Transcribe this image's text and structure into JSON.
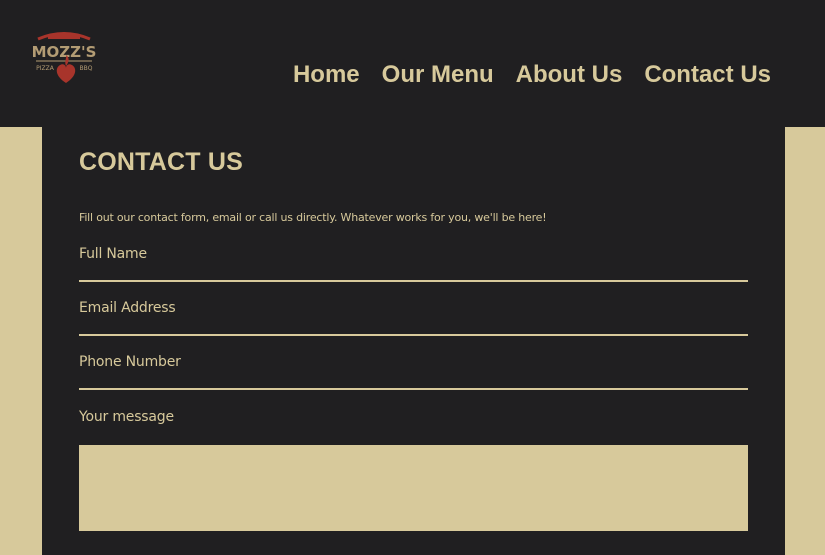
{
  "colors": {
    "dark": "#201f21",
    "tan": "#d7c99b",
    "logo_red": "#a8342b",
    "logo_tan": "#b39c74"
  },
  "logo": {
    "name": "MOZZ'S",
    "left_word": "PIZZA",
    "right_word": "BBQ",
    "icon": "flame-heart-icon"
  },
  "nav": {
    "items": [
      {
        "label": "Home"
      },
      {
        "label": "Our Menu"
      },
      {
        "label": "About Us"
      },
      {
        "label": "Contact Us"
      }
    ]
  },
  "page": {
    "title": "CONTACT US",
    "intro": "Fill out our contact form, email or call us directly. Whatever works for you, we'll be here!"
  },
  "form": {
    "full_name": {
      "label": "Full Name",
      "value": ""
    },
    "email": {
      "label": "Email Address",
      "value": ""
    },
    "phone": {
      "label": "Phone Number",
      "value": ""
    },
    "message": {
      "label": "Your message",
      "value": ""
    }
  }
}
